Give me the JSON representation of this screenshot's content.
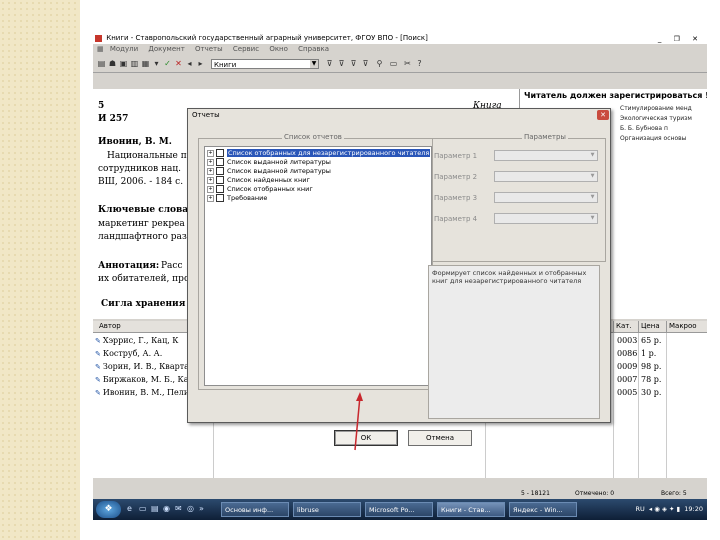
{
  "app": {
    "title": "Книги - Ставропольский государственный аграрный университет, ФГОУ ВПО - [Поиск]",
    "menu": [
      "Модули",
      "Документ",
      "Отчеты",
      "Сервис",
      "Окно",
      "Справка"
    ],
    "toolbar_combo": "Книги"
  },
  "record": {
    "line1": "5",
    "line2": "И 257",
    "badge": "Книга",
    "author": "Ивонин, В. М.",
    "text1": "Национальные п",
    "text2": "сотрудников нац.",
    "text3": "ВШ, 2006. - 184 с.",
    "kw_label": "Ключевые слова",
    "kw1": "маркетинг рекреа",
    "kw2": "ландшафтного раз",
    "ann_label": "Аннотация:",
    "ann_text": "Расс",
    "ann2": "их обитателей, про",
    "sigla": "Сигла хранения"
  },
  "right_panel": {
    "title": "Читатель должен зарегистрироваться !!!",
    "items": [
      "Стимулирование менд",
      "Экологическая туризм",
      "Б. Б. Бубнова п",
      "Организация основы"
    ]
  },
  "list": {
    "headers": [
      "Автор",
      "Кат.",
      "Цена",
      "Макроо"
    ],
    "rows": [
      {
        "author": "Хэррис, Г., Кац, К",
        "num": "0003",
        "price": "65 р."
      },
      {
        "author": "Коструб, А. А.",
        "num": "0086",
        "price": "1 р."
      },
      {
        "author": "Зорин, И. В., Кварта",
        "num": "0009",
        "price": "98 р."
      },
      {
        "author": "Биржаков, М. Б., Ка",
        "num": "0007",
        "price": "78 р."
      },
      {
        "author": "Ивонин, В. М., Пели",
        "num": "0005",
        "price": "30 р."
      }
    ]
  },
  "status": {
    "left": "5 - 18121",
    "mid": "Отмечено: 0",
    "right": "Всего: 5"
  },
  "taskbar": {
    "tasks": [
      "Основы инф...",
      "libruse",
      "Microsoft Po...",
      "Книги - Став...",
      "Яндекс - Win..."
    ],
    "lang": "RU",
    "time": "19:20"
  },
  "dialog": {
    "title": "Отчеты",
    "reports_group": "Список отчетов",
    "params_group": "Параметры",
    "reports": [
      "Список отобранных для незарегистрированного читателя",
      "Список выданной литературы",
      "Список выданной литературы",
      "Список найденных книг",
      "Список отобранных книг",
      "Требование"
    ],
    "params": [
      "Параметр 1",
      "Параметр 2",
      "Параметр 3",
      "Параметр 4"
    ],
    "description": "Формирует список найденных и отобранных книг для незарегистрированного читателя",
    "ok": "ОК",
    "cancel": "Отмена"
  }
}
